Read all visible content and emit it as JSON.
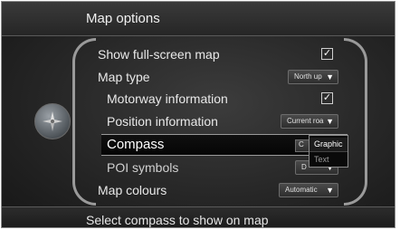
{
  "header": {
    "title": "Map options"
  },
  "menu": {
    "items": [
      {
        "label": "Show full-screen map",
        "check": "✓"
      },
      {
        "label": "Map type",
        "value": "North up",
        "arrow": "▼"
      },
      {
        "label": "Motorway information",
        "check": "✓"
      },
      {
        "label": "Position information",
        "value": "Current roa",
        "arrow": "▼"
      },
      {
        "label": "Compass",
        "value_fragment": "C"
      },
      {
        "label": "POI symbols",
        "value_fragment": "D",
        "arrow": "▼"
      },
      {
        "label": "Map colours",
        "value": "Automatic",
        "arrow": "▼"
      }
    ]
  },
  "dropdown": {
    "options": [
      {
        "label": "Graphic"
      },
      {
        "label": "Text"
      }
    ]
  },
  "footer": {
    "hint": "Select compass to show on map"
  },
  "colors": {
    "background": "#262626",
    "selected_row": "#050505",
    "text": "#e8e8e8"
  },
  "icons": {
    "knob": "compass-rose-icon",
    "checkbox": "checkmark-icon",
    "select": "triangle-down-icon"
  }
}
